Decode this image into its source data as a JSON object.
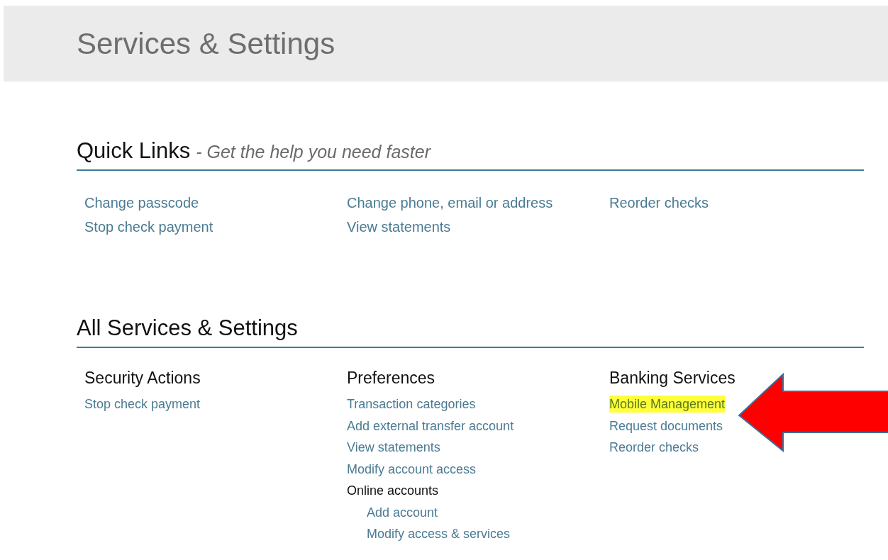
{
  "header": {
    "title": "Services & Settings"
  },
  "quick_links": {
    "title": "Quick Links",
    "subtitle": "- Get the help you need faster",
    "columns": [
      {
        "items": [
          "Change passcode",
          "Stop check payment"
        ]
      },
      {
        "items": [
          "Change phone, email or address",
          "View statements"
        ]
      },
      {
        "items": [
          "Reorder checks"
        ]
      }
    ]
  },
  "all_services": {
    "title": "All Services & Settings",
    "groups": [
      {
        "title": "Security Actions",
        "items": [
          {
            "label": "Stop check payment",
            "kind": "link",
            "highlighted": false
          }
        ]
      },
      {
        "title": "Preferences",
        "items": [
          {
            "label": "Transaction categories",
            "kind": "link",
            "highlighted": false
          },
          {
            "label": "Add external transfer account",
            "kind": "link",
            "highlighted": false
          },
          {
            "label": "View statements",
            "kind": "link",
            "highlighted": false
          },
          {
            "label": "Modify account access",
            "kind": "link",
            "highlighted": false
          },
          {
            "label": "Online accounts",
            "kind": "label",
            "children": [
              {
                "label": "Add account",
                "kind": "link",
                "highlighted": false
              },
              {
                "label": "Modify access & services",
                "kind": "link",
                "highlighted": false
              }
            ]
          }
        ]
      },
      {
        "title": "Banking Services",
        "items": [
          {
            "label": "Mobile Management",
            "kind": "link",
            "highlighted": true
          },
          {
            "label": "Request documents",
            "kind": "link",
            "highlighted": false
          },
          {
            "label": "Reorder checks",
            "kind": "link",
            "highlighted": false
          }
        ]
      }
    ]
  },
  "annotation": {
    "kind": "arrow"
  }
}
